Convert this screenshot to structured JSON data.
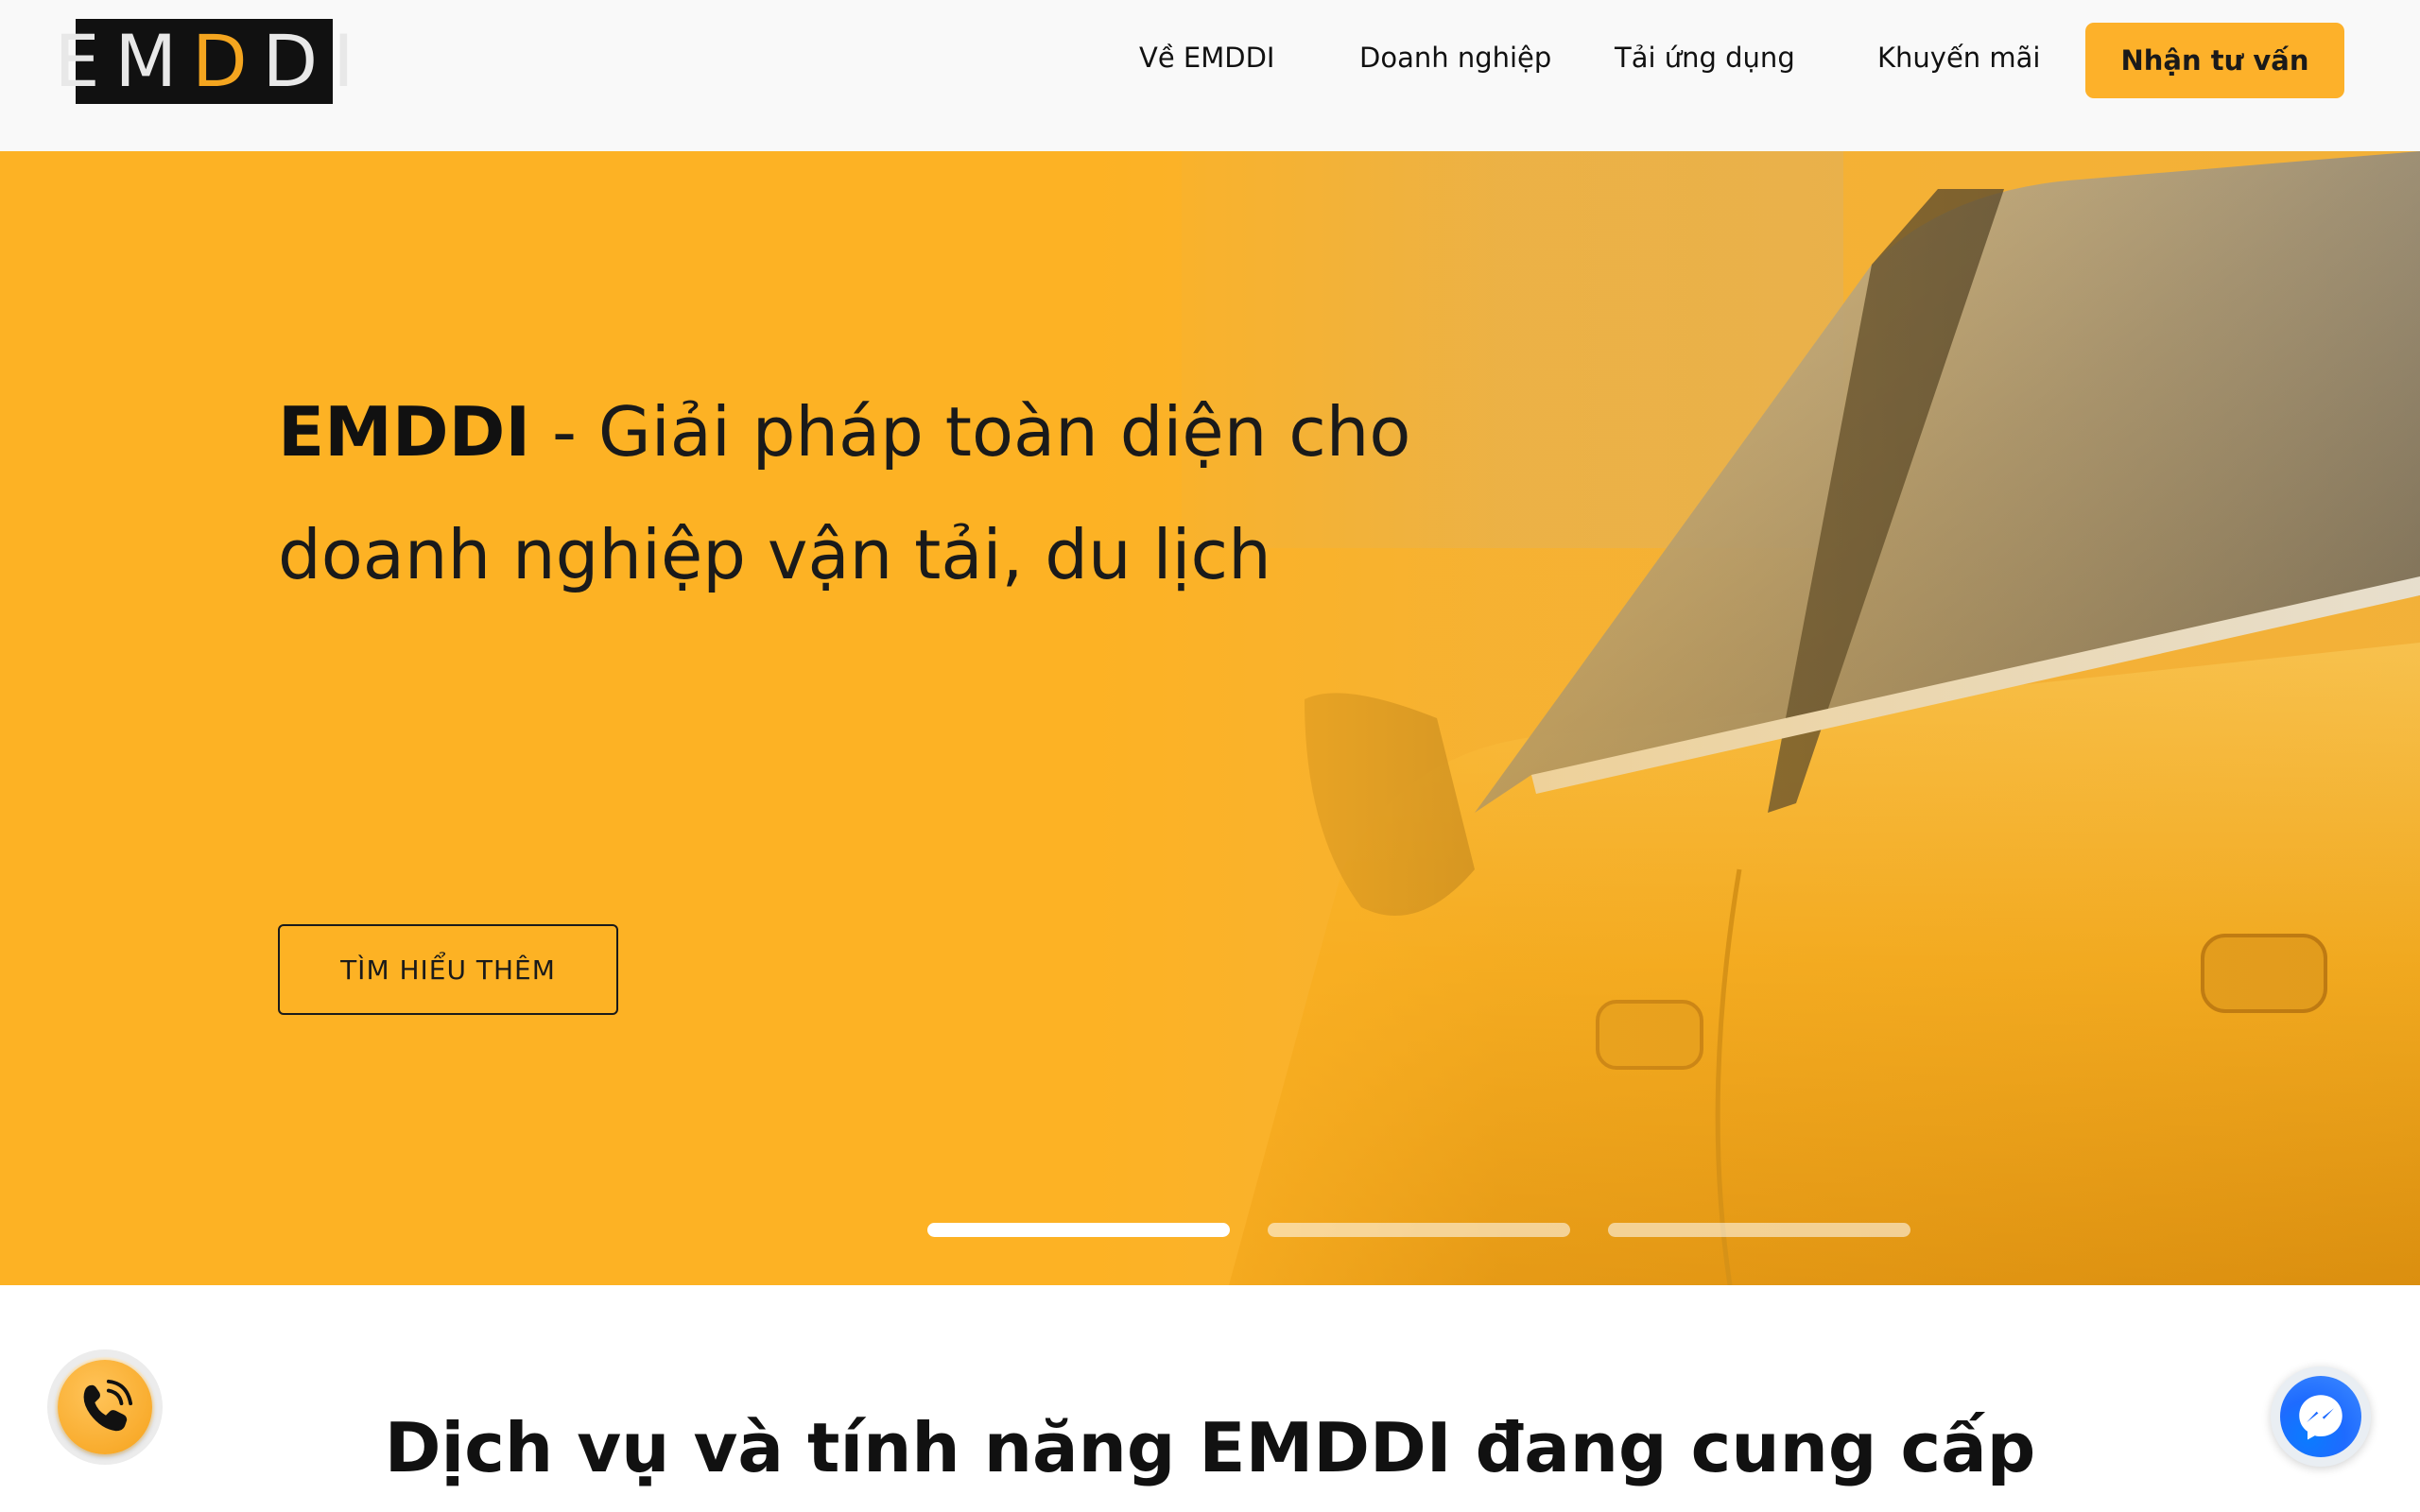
{
  "header": {
    "logo_text": "EMDDI",
    "nav": [
      {
        "label": "Về EMDDI"
      },
      {
        "label": "Doanh nghiệp"
      },
      {
        "label": "Tải ứng dụng"
      },
      {
        "label": "Khuyến mãi"
      }
    ],
    "cta_label": "Nhận tư vấn"
  },
  "hero": {
    "brand": "EMDDI",
    "title_rest": " - Giải pháp toàn diện cho doanh nghiệp vận tải, du lịch",
    "button_label": "TÌM HIỂU THÊM",
    "slides_total": 3,
    "active_slide": 1
  },
  "section": {
    "title": "Dịch vụ và tính năng EMDDI đang cung cấp"
  },
  "floating": {
    "phone_icon": "phone-call-icon",
    "messenger_icon": "messenger-icon"
  },
  "colors": {
    "accent": "#fdb12a",
    "hero_bg": "#fdb224",
    "messenger_blue": "#1e6bff"
  }
}
